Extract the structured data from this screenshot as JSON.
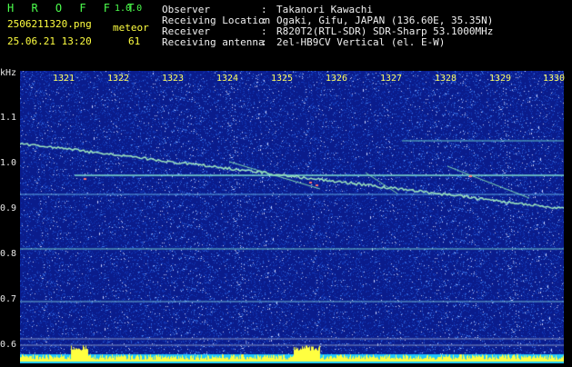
{
  "app": {
    "brand": "H R O F F T",
    "version": "1.0.0"
  },
  "file": {
    "name": "2506211320.png",
    "datetime": "25.06.21 13:20"
  },
  "meteor": {
    "label": "meteor",
    "count": "61"
  },
  "info": [
    {
      "key": "Observer",
      "sep": ":",
      "value": "Takanori Kawachi"
    },
    {
      "key": "Receiving Location",
      "sep": ":",
      "value": "Ogaki, Gifu, JAPAN (136.60E, 35.35N)"
    },
    {
      "key": "Receiver",
      "sep": ":",
      "value": "R820T2(RTL-SDR) SDR-Sharp 53.1000MHz"
    },
    {
      "key": "Receiving antenna",
      "sep": ":",
      "value": "2el-HB9CV Vertical (el. E-W)"
    }
  ],
  "axis": {
    "y_unit": "kHz",
    "y_ticks": [
      "1.1",
      "1.0",
      "0.9",
      "0.8",
      "0.7",
      "0.6"
    ],
    "x_ticks": [
      "1321",
      "1322",
      "1323",
      "1324",
      "1325",
      "1326",
      "1327",
      "1328",
      "1329",
      "1330"
    ]
  },
  "colors": {
    "background": "#000000",
    "plot_bg": "#0a1a8a",
    "label": "#ffff40",
    "brand": "#4cff4c",
    "lines": "#7fdcc8",
    "bottom": "#18c8ff"
  }
}
